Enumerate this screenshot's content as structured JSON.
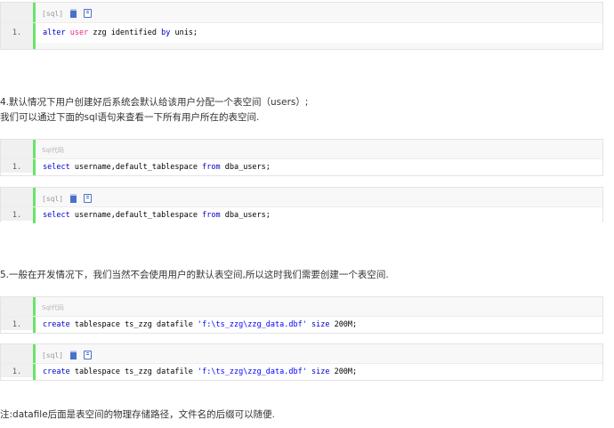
{
  "blocks": [
    {
      "header": "[sql]",
      "has_icons": true,
      "line_num": "1.",
      "tokens": [
        {
          "t": "alter",
          "c": "kw"
        },
        {
          "t": " "
        },
        {
          "t": "user",
          "c": "kw2"
        },
        {
          "t": " zzg identified "
        },
        {
          "t": "by",
          "c": "kw"
        },
        {
          "t": " unis;"
        }
      ]
    },
    {
      "header": "Sql代码",
      "has_icons": false,
      "line_num": "1.",
      "tokens": [
        {
          "t": "select",
          "c": "kw"
        },
        {
          "t": " username,default_tablespace "
        },
        {
          "t": "from",
          "c": "kw"
        },
        {
          "t": " dba_users;"
        }
      ]
    },
    {
      "header": "[sql]",
      "has_icons": true,
      "line_num": "1.",
      "tokens": [
        {
          "t": "select",
          "c": "kw"
        },
        {
          "t": " username,default_tablespace "
        },
        {
          "t": "from",
          "c": "kw"
        },
        {
          "t": " dba_users;"
        }
      ]
    },
    {
      "header": "Sql代码",
      "has_icons": false,
      "line_num": "1.",
      "tokens": [
        {
          "t": "create",
          "c": "kw"
        },
        {
          "t": " tablespace ts_zzg datafile "
        },
        {
          "t": "'f:\\ts_zzg\\zzg_data.dbf'",
          "c": "str"
        },
        {
          "t": " "
        },
        {
          "t": "size",
          "c": "kw"
        },
        {
          "t": " 200M;"
        }
      ]
    },
    {
      "header": "[sql]",
      "has_icons": true,
      "line_num": "1.",
      "tokens": [
        {
          "t": "create",
          "c": "kw"
        },
        {
          "t": " tablespace ts_zzg datafile "
        },
        {
          "t": "'f:\\ts_zzg\\zzg_data.dbf'",
          "c": "str"
        },
        {
          "t": " "
        },
        {
          "t": "size",
          "c": "kw"
        },
        {
          "t": " 200M;"
        }
      ]
    }
  ],
  "paragraphs": {
    "p4_line1": "4.默认情况下用户创建好后系统会默认给该用户分配一个表空间（users）;",
    "p4_line2": "我们可以通过下面的sql语句来查看一下所有用户所在的表空间.",
    "p5": "5.一般在开发情况下，我们当然不会使用用户的默认表空间,所以这时我们需要创建一个表空间.",
    "note": "注:datafile后面是表空间的物理存储路径，文件名的后缀可以随便."
  },
  "colors": {
    "keyword": "#0000cc",
    "keyword_alt": "#e4268b",
    "string": "#0000ff",
    "gutter_bar": "#6ce26c"
  }
}
